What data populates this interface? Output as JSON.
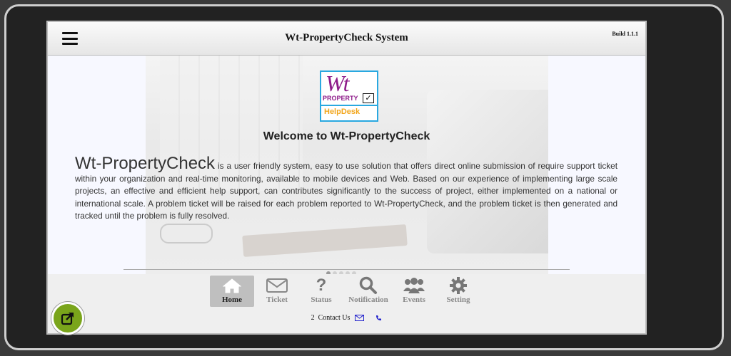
{
  "header": {
    "title": "Wt-PropertyCheck System",
    "build": "Build 1.1.1"
  },
  "logo": {
    "wt": "Wt",
    "property": "PROPERTY",
    "helpdesk": "HelpDesk"
  },
  "main": {
    "welcome": "Welcome to Wt-PropertyCheck",
    "intro_big": "Wt-PropertyCheck",
    "intro_text": " is a user friendly system, easy to use solution that offers direct online submission of require support ticket within your organization and real-time monitoring, available to mobile devices and Web. Based on our experience of implementing large scale projects, an effective and efficient help support, can contributes significantly to the success of project, either implemented on a national or international scale. A problem ticket will be raised for each problem reported to Wt-PropertyCheck, and the problem ticket is then generated and tracked until the problem is fully resolved."
  },
  "nav": {
    "items": [
      {
        "label": "Home",
        "icon": "home-icon",
        "active": true
      },
      {
        "label": "Ticket",
        "icon": "envelope-icon",
        "active": false
      },
      {
        "label": "Status",
        "icon": "question-icon",
        "active": false
      },
      {
        "label": "Notification",
        "icon": "search-icon",
        "active": false
      },
      {
        "label": "Events",
        "icon": "users-icon",
        "active": false
      },
      {
        "label": "Setting",
        "icon": "gear-icon",
        "active": false
      }
    ]
  },
  "footer": {
    "count": "2",
    "contact_label": "Contact Us"
  },
  "colors": {
    "accent_green": "#7aa51b",
    "logo_purple": "#8e1b8a",
    "logo_border": "#29a8e0",
    "logo_orange": "#f2a51a"
  }
}
